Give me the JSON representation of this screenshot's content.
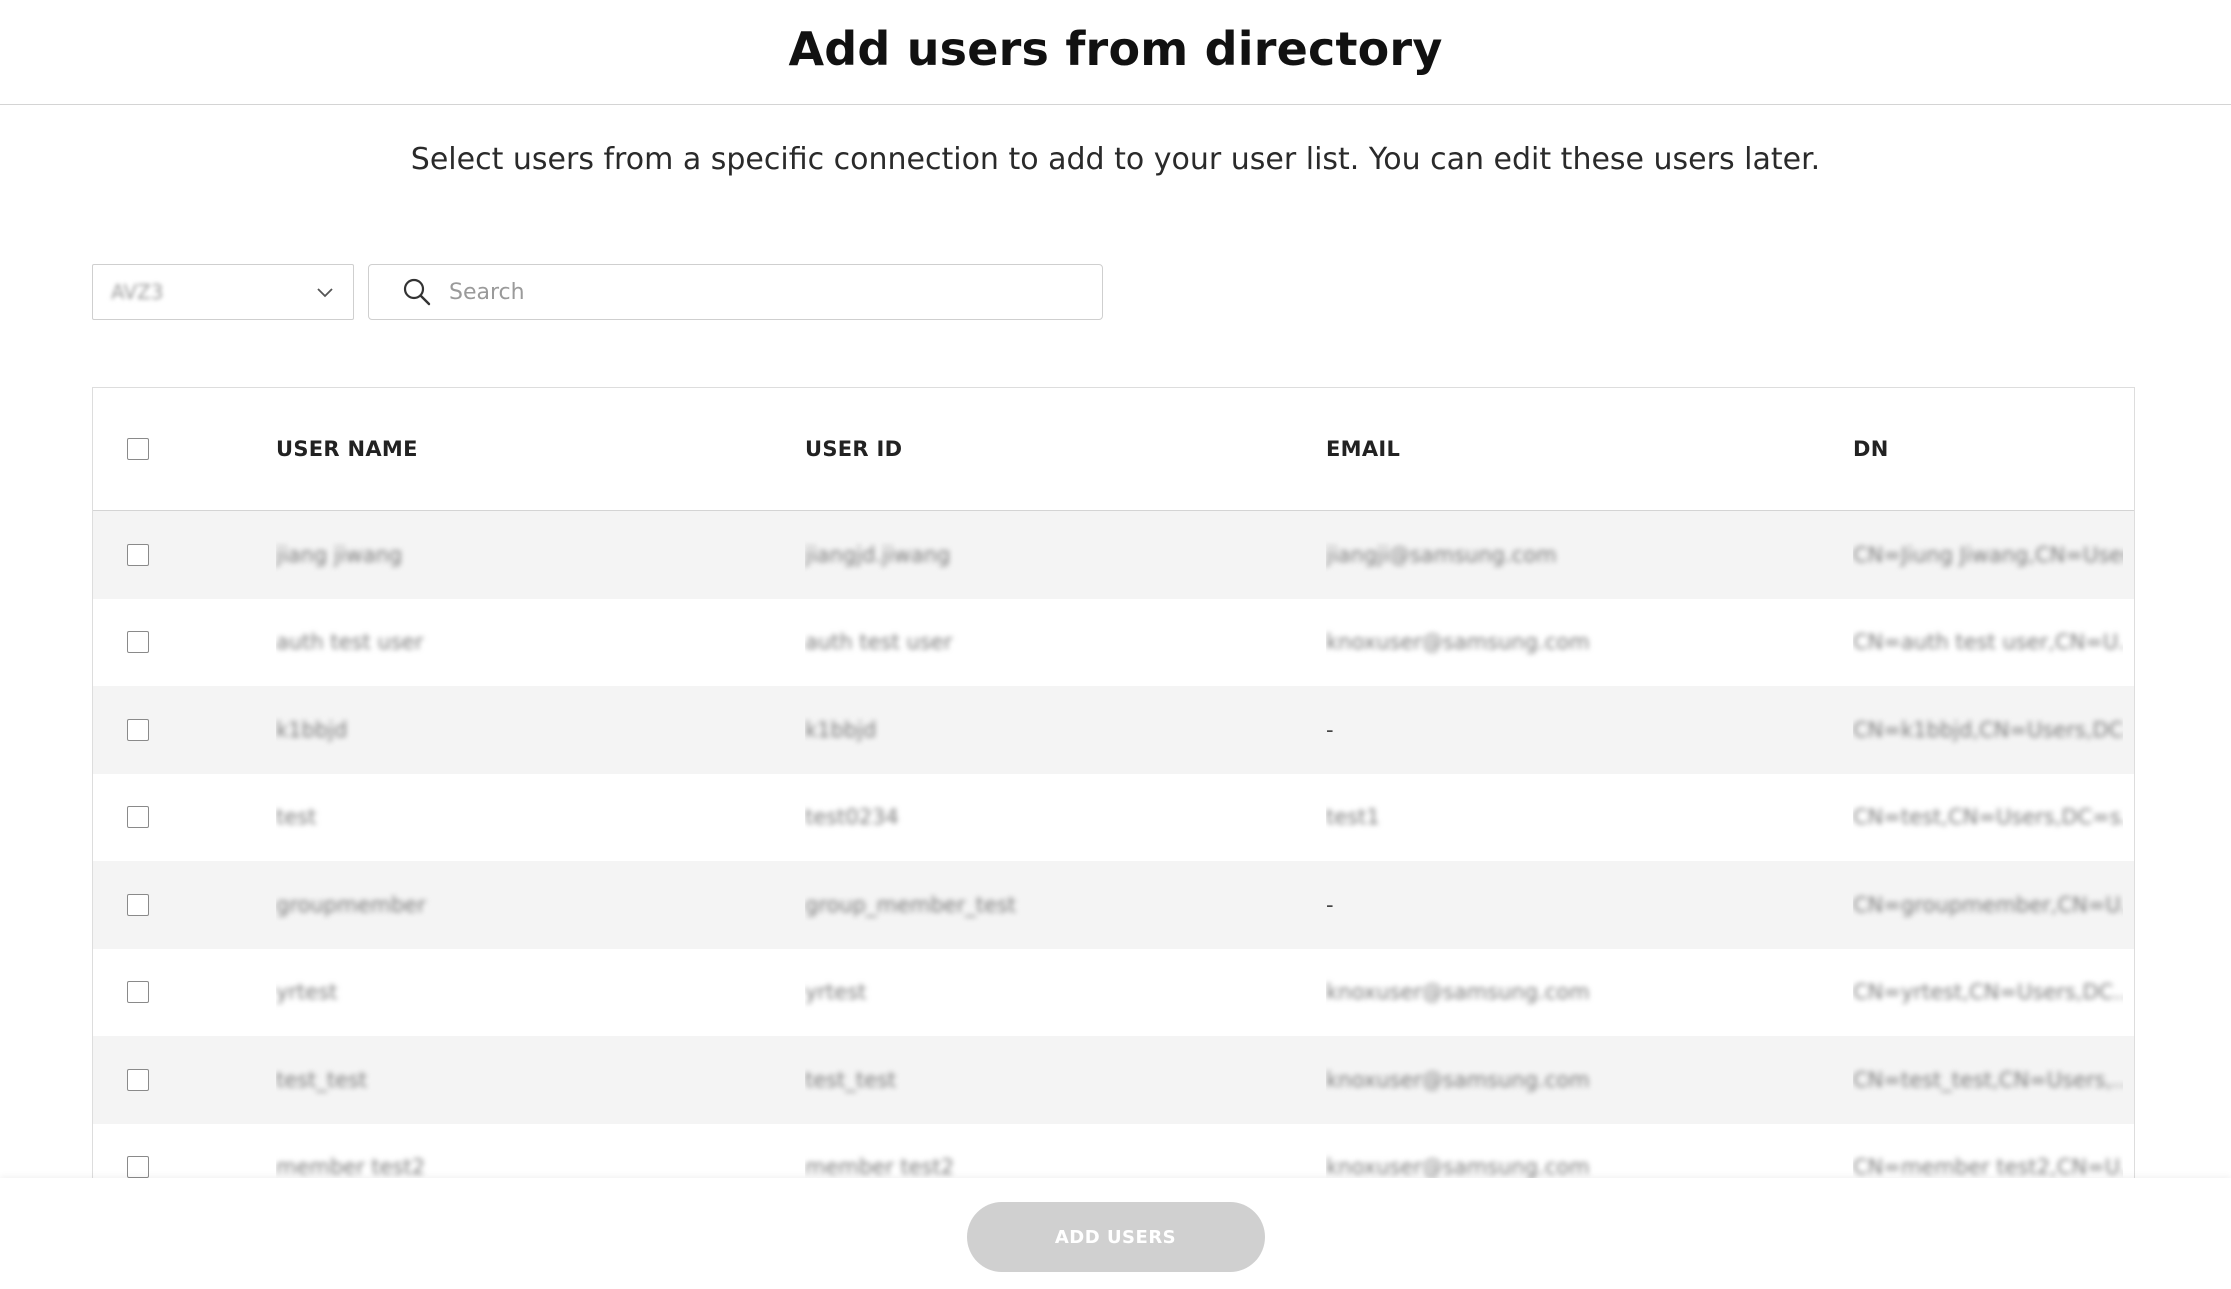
{
  "header": {
    "title": "Add users from directory"
  },
  "subtitle": "Select users from a specific connection to add to your user list. You can edit these users later.",
  "toolbar": {
    "connection_selected": "AVZ3",
    "search_placeholder": "Search"
  },
  "table": {
    "columns": [
      "USER NAME",
      "USER ID",
      "EMAIL",
      "DN"
    ],
    "rows": [
      {
        "name": "jiang jiwang",
        "id": "jiangjd.jiwang",
        "email": "jiangji@samsung.com",
        "dn": "CN=Jiung Jiwang,CN=User..."
      },
      {
        "name": "auth test user",
        "id": "auth test user",
        "email": "knoxuser@samsung.com",
        "dn": "CN=auth test user,CN=U..."
      },
      {
        "name": "k1bbjd",
        "id": "k1bbjd",
        "email": "-",
        "dn": "CN=k1bbjd,CN=Users,DC..."
      },
      {
        "name": "test",
        "id": "test0234",
        "email": "test1",
        "dn": "CN=test,CN=Users,DC=s..."
      },
      {
        "name": "groupmember",
        "id": "group_member_test",
        "email": "-",
        "dn": "CN=groupmember,CN=U..."
      },
      {
        "name": "yrtest",
        "id": "yrtest",
        "email": "knoxuser@samsung.com",
        "dn": "CN=yrtest,CN=Users,DC..."
      },
      {
        "name": "test_test",
        "id": "test_test",
        "email": "knoxuser@samsung.com",
        "dn": "CN=test_test,CN=Users,..."
      },
      {
        "name": "member test2",
        "id": "member test2",
        "email": "knoxuser@samsung.com",
        "dn": "CN=member test2,CN=U..."
      }
    ]
  },
  "footer": {
    "add_label": "ADD USERS"
  },
  "colors": {
    "border": "#dddddd",
    "row_alt": "#f4f4f4",
    "button_disabled": "#d0d0d0"
  }
}
